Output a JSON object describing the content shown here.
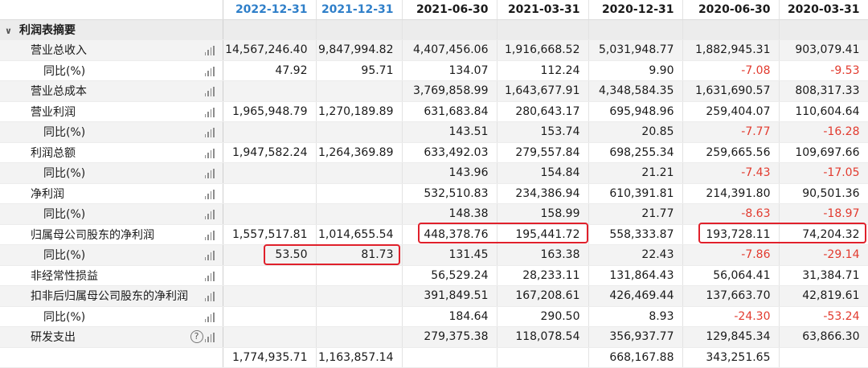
{
  "columns": [
    "2022-12-31",
    "2021-12-31",
    "2021-06-30",
    "2021-03-31",
    "2020-12-31",
    "2020-06-30",
    "2020-03-31"
  ],
  "header_colors": {
    "highlighted_dates": "#2f7fc9",
    "negative_value": "#e23b2f",
    "highlight_box": "#e0202b"
  },
  "section": {
    "label": "利润表摘要",
    "icon": "chevron-down-icon"
  },
  "rows": [
    {
      "label": "营业总收入",
      "sub": false,
      "values": [
        "14,567,246.40",
        "9,847,994.82",
        "4,407,456.06",
        "1,916,668.52",
        "5,031,948.77",
        "1,882,945.31",
        "903,079.41"
      ]
    },
    {
      "label": "同比(%)",
      "sub": true,
      "values": [
        "47.92",
        "95.71",
        "134.07",
        "112.24",
        "9.90",
        "-7.08",
        "-9.53"
      ]
    },
    {
      "label": "营业总成本",
      "sub": false,
      "values": [
        "",
        "",
        "3,769,858.99",
        "1,643,677.91",
        "4,348,584.35",
        "1,631,690.57",
        "808,317.33"
      ]
    },
    {
      "label": "营业利润",
      "sub": false,
      "values": [
        "1,965,948.79",
        "1,270,189.89",
        "631,683.84",
        "280,643.17",
        "695,948.96",
        "259,404.07",
        "110,604.64"
      ]
    },
    {
      "label": "同比(%)",
      "sub": true,
      "values": [
        "",
        "",
        "143.51",
        "153.74",
        "20.85",
        "-7.77",
        "-16.28"
      ]
    },
    {
      "label": "利润总额",
      "sub": false,
      "values": [
        "1,947,582.24",
        "1,264,369.89",
        "633,492.03",
        "279,557.84",
        "698,255.34",
        "259,665.56",
        "109,697.66"
      ]
    },
    {
      "label": "同比(%)",
      "sub": true,
      "values": [
        "",
        "",
        "143.96",
        "154.84",
        "21.21",
        "-7.43",
        "-17.05"
      ]
    },
    {
      "label": "净利润",
      "sub": false,
      "values": [
        "",
        "",
        "532,510.83",
        "234,386.94",
        "610,391.81",
        "214,391.80",
        "90,501.36"
      ]
    },
    {
      "label": "同比(%)",
      "sub": true,
      "values": [
        "",
        "",
        "148.38",
        "158.99",
        "21.77",
        "-8.63",
        "-18.97"
      ]
    },
    {
      "label": "归属母公司股东的净利润",
      "sub": false,
      "values": [
        "1,557,517.81",
        "1,014,655.54",
        "448,378.76",
        "195,441.72",
        "558,333.87",
        "193,728.11",
        "74,204.32"
      ]
    },
    {
      "label": "同比(%)",
      "sub": true,
      "values": [
        "53.50",
        "81.73",
        "131.45",
        "163.38",
        "22.43",
        "-7.86",
        "-29.14"
      ]
    },
    {
      "label": "非经常性损益",
      "sub": false,
      "values": [
        "",
        "",
        "56,529.24",
        "28,233.11",
        "131,864.43",
        "56,064.41",
        "31,384.71"
      ]
    },
    {
      "label": "扣非后归属母公司股东的净利润",
      "sub": false,
      "values": [
        "",
        "",
        "391,849.51",
        "167,208.61",
        "426,469.44",
        "137,663.70",
        "42,819.61"
      ]
    },
    {
      "label": "同比(%)",
      "sub": true,
      "values": [
        "",
        "",
        "184.64",
        "290.50",
        "8.93",
        "-24.30",
        "-53.24"
      ]
    },
    {
      "label": "研发支出",
      "sub": false,
      "help": true,
      "values": [
        "",
        "",
        "279,375.38",
        "118,078.54",
        "356,937.77",
        "129,845.34",
        "63,866.30"
      ]
    },
    {
      "label": "",
      "sub": false,
      "values": [
        "1,774,935.71",
        "1,163,857.14",
        "",
        "",
        "668,167.88",
        "343,251.65",
        ""
      ]
    }
  ]
}
